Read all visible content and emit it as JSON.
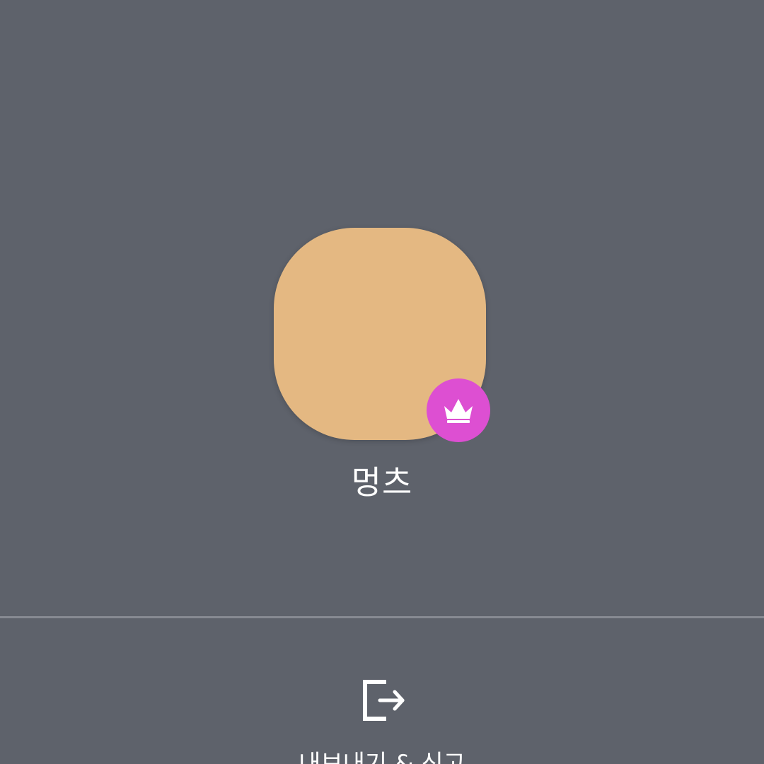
{
  "profile": {
    "name": "멍츠",
    "avatar_color": "#e4b882",
    "badge": {
      "icon": "crown-icon",
      "color": "#dd4fd2"
    }
  },
  "actions": [
    {
      "icon": "exit-icon",
      "label": "내보내기 & 신고"
    }
  ],
  "theme": {
    "background": "#5e626b",
    "divider": "#878a92"
  }
}
